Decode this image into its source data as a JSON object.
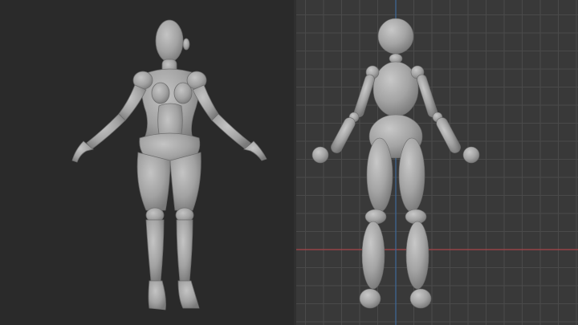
{
  "scene": {
    "description_free": true,
    "left_view": {
      "shading": "solid",
      "subject": "female-figure-mesh"
    },
    "right_view": {
      "shading": "solid",
      "subject": "mannequin-figure",
      "grid": true,
      "axes": [
        "x",
        "z"
      ]
    }
  },
  "colors": {
    "left_background": "#2a2a2a",
    "right_background": "#393939",
    "grid_line": "#4a4a4a",
    "grid_major": "#525252",
    "x_axis": "#a8454a",
    "z_axis": "#3e6a9a",
    "mesh": "#a9a9a9"
  },
  "icons": [
    "mesh-figure-icon",
    "mannequin-figure-icon"
  ]
}
